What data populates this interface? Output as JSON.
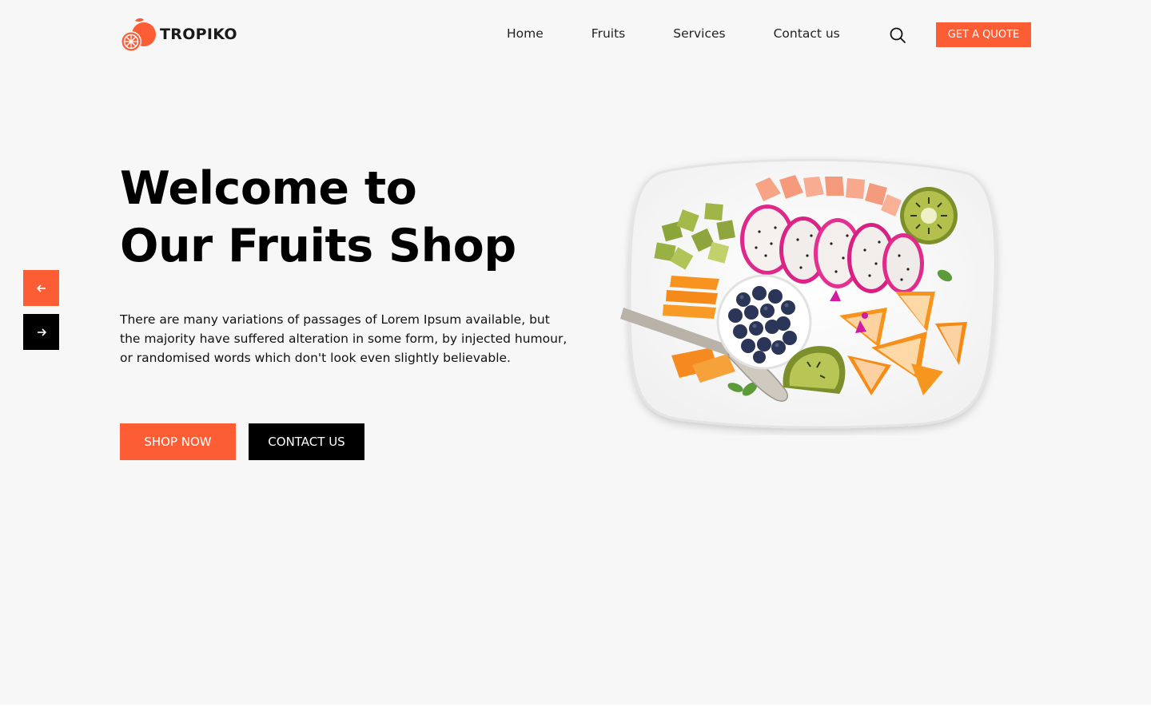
{
  "brand": {
    "name": "TROPIKO",
    "accent_color": "#fc5d35",
    "icon": "orange-logo-icon"
  },
  "nav": {
    "items": [
      "Home",
      "Fruits",
      "Services",
      "Contact us"
    ],
    "search_icon": "search-icon",
    "quote_label": "GET A QUOTE"
  },
  "hero": {
    "title_line1": "Welcome to",
    "title_line2": "Our Fruits Shop",
    "description": "There are many variations of passages of Lorem Ipsum available, but the majority have suffered alteration in some form, by injected humour, or randomised words which don't look even slightly believable.",
    "shop_label": "SHOP NOW",
    "contact_label": "CONTACT US",
    "image": "fruit-platter-image"
  },
  "slider": {
    "prev_icon": "arrow-left-icon",
    "next_icon": "arrow-right-icon"
  }
}
